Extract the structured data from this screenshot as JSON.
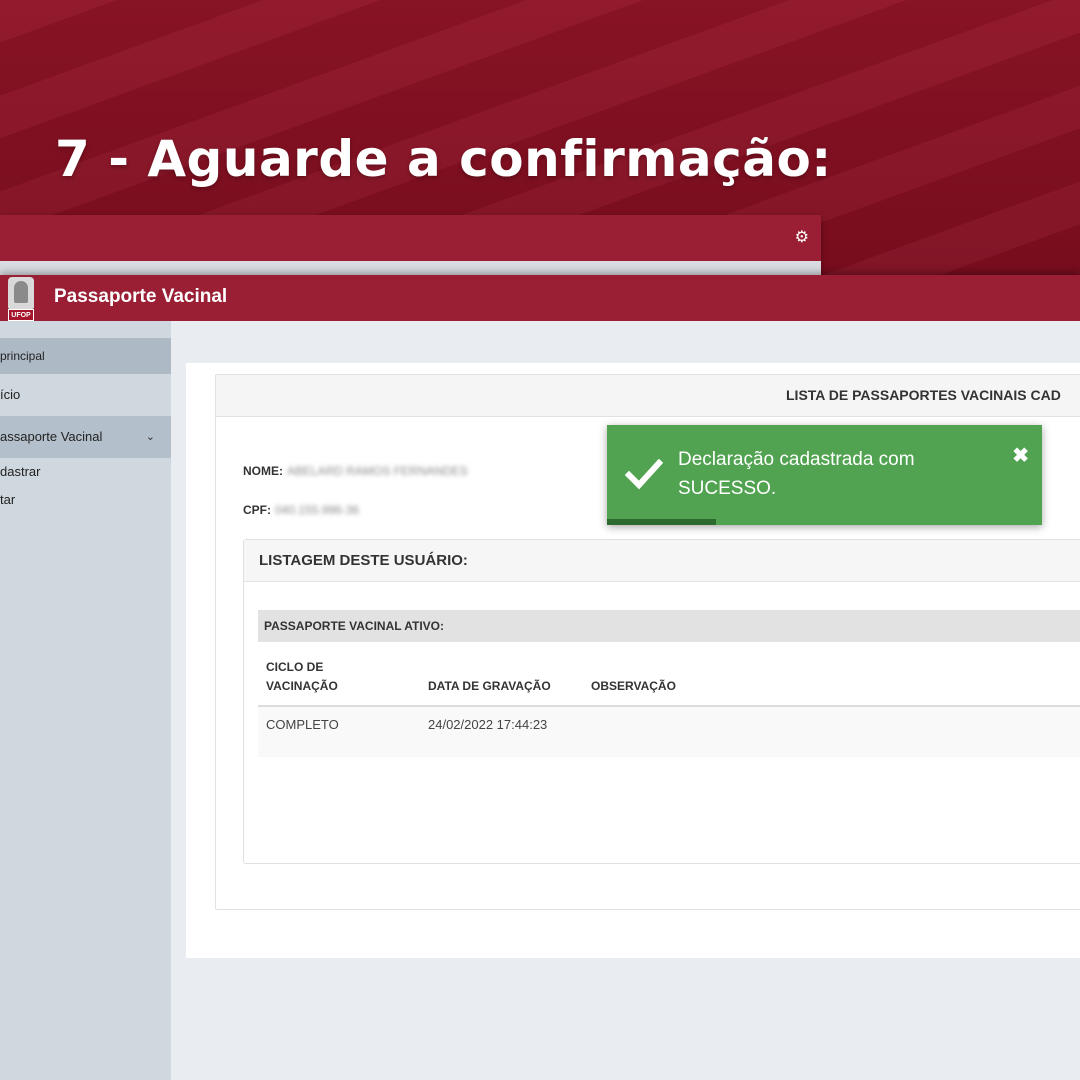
{
  "banner": {
    "heading": "7 - Aguarde a confirmação:"
  },
  "app": {
    "title": "Passaporte Vacinal",
    "logo_text": "UFOP"
  },
  "sidebar": {
    "section": "principal",
    "items": [
      {
        "label": "ício"
      },
      {
        "label": "assaporte Vacinal",
        "chevron": "⌄"
      }
    ],
    "subitems": [
      {
        "label": "dastrar"
      },
      {
        "label": "tar"
      }
    ]
  },
  "card": {
    "header": "LISTA DE PASSAPORTES VACINAIS CAD",
    "nome_label": "NOME:",
    "nome_value": "ABELARD RAMOS FERNANDES",
    "cpf_label": "CPF:",
    "cpf_value": "040.155.996-36"
  },
  "listing": {
    "title": "LISTAGEM DESTE USUÁRIO:",
    "caption": "PASSAPORTE VACINAL ATIVO:",
    "columns": [
      "CICLO DE\nVACINAÇÃO",
      "DATA DE GRAVAÇÃO",
      "OBSERVAÇÃO"
    ],
    "rows": [
      {
        "ciclo": "COMPLETO",
        "data": "24/02/2022 17:44:23",
        "obs": ""
      }
    ]
  },
  "toast": {
    "line1": "Declaração cadastrada com",
    "line2": "SUCESSO.",
    "close": "✖",
    "progress": 0.25,
    "color": "#51a351"
  },
  "colors": {
    "brand": "#9a1f35",
    "sidebar": "#cfd7df"
  },
  "icons": {
    "settings": "gears-icon",
    "success": "check-icon",
    "close": "close-icon"
  }
}
